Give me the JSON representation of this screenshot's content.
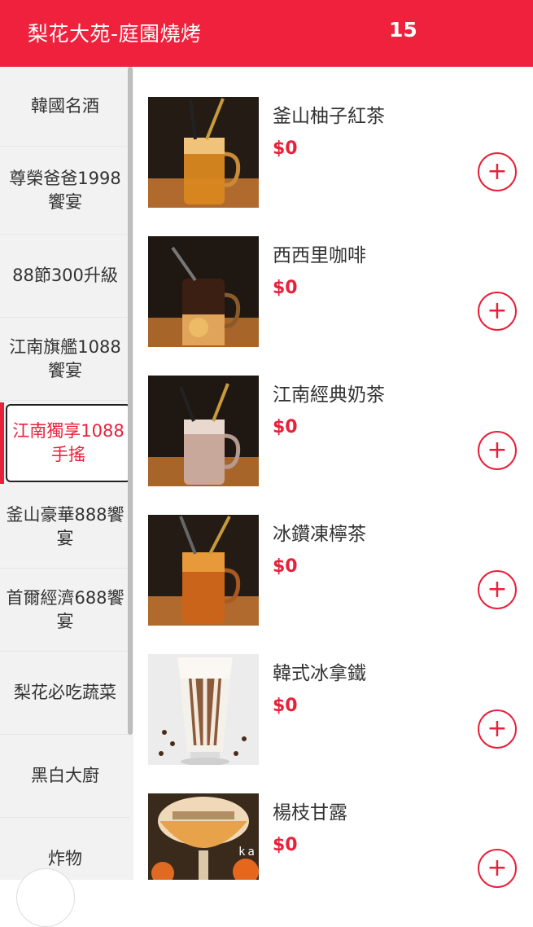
{
  "header": {
    "title": "梨花大苑-庭園燒烤",
    "count": "15"
  },
  "sidebar": {
    "items": [
      {
        "label": "韓國名酒"
      },
      {
        "label": "尊榮爸爸1998饗宴"
      },
      {
        "label": "88節300升級"
      },
      {
        "label": "江南旗艦1088饗宴"
      },
      {
        "label": "江南獨享1088手搖",
        "active": true
      },
      {
        "label": "釜山豪華888饗宴"
      },
      {
        "label": "首爾經濟688饗宴"
      },
      {
        "label": "梨花必吃蔬菜"
      },
      {
        "label": "黑白大廚"
      },
      {
        "label": "炸物"
      }
    ]
  },
  "products": [
    {
      "name": "釜山柚子紅茶",
      "price": "$0",
      "image": "iced-citron-tea",
      "add_icon": "plus-icon"
    },
    {
      "name": "西西里咖啡",
      "price": "$0",
      "image": "sicilian-coffee",
      "add_icon": "plus-icon"
    },
    {
      "name": "江南經典奶茶",
      "price": "$0",
      "image": "milk-tea",
      "add_icon": "plus-icon"
    },
    {
      "name": "冰鑽凍檸茶",
      "price": "$0",
      "image": "iced-lemon-tea",
      "add_icon": "plus-icon"
    },
    {
      "name": "韓式冰拿鐵",
      "price": "$0",
      "image": "korean-iced-latte",
      "add_icon": "plus-icon"
    },
    {
      "name": "楊枝甘露",
      "price": "$0",
      "image": "mango-pomelo-sago",
      "add_icon": "plus-icon"
    }
  ],
  "watermark": "ka",
  "colors": {
    "brand": "#f0213c",
    "accent": "#e8213a",
    "sidebar_bg": "#f2f2f2"
  }
}
